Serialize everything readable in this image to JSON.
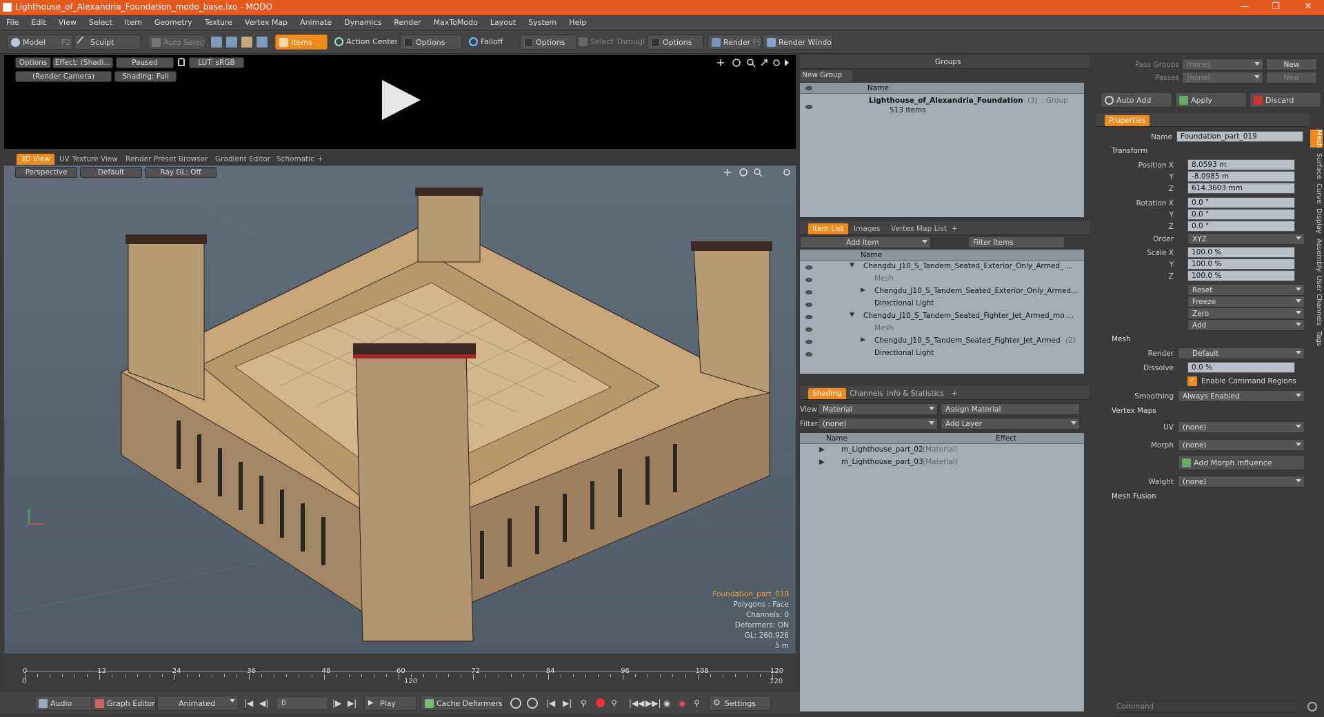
{
  "window": {
    "title": "Lighthouse_of_Alexandria_Foundation_modo_base.lxo - MODO",
    "minimize": "—",
    "maximize": "❐",
    "close": "✕"
  },
  "menu": [
    "File",
    "Edit",
    "View",
    "Select",
    "Item",
    "Geometry",
    "Texture",
    "Vertex Map",
    "Animate",
    "Dynamics",
    "Render",
    "MaxToModo",
    "Layout",
    "System",
    "Help"
  ],
  "toolbar": {
    "model": "Model",
    "model_key": "F2",
    "sculpt": "Sculpt",
    "auto_select": "Auto Select",
    "items": "Items",
    "action_center": "Action Center",
    "options1": "Options",
    "falloff": "Falloff",
    "options2": "Options",
    "select_through": "Select Through",
    "options3": "Options",
    "render": "Render",
    "render_key": "F9",
    "render_window": "Render Window"
  },
  "preview": {
    "options": "Options",
    "effect": "Effect: (Shadi...",
    "paused": "Paused",
    "lut": "LUT: sRGB",
    "camera": "(Render Camera)",
    "shading": "Shading: Full"
  },
  "viewport_tabs": [
    "3D View",
    "UV Texture View",
    "Render Preset Browser",
    "Gradient Editor",
    "Schematic",
    "+"
  ],
  "viewport": {
    "perspective": "Perspective",
    "default": "Default",
    "raygl": "Ray GL: Off",
    "info": {
      "name": "Foundation_part_019",
      "polygons": "Polygons : Face",
      "channels": "Channels: 0",
      "deformers": "Deformers: ON",
      "gl": "GL: 260,926",
      "scale": "5 m"
    }
  },
  "timeline": {
    "marks": [
      "0",
      "12",
      "24",
      "36",
      "48",
      "60",
      "72",
      "84",
      "96",
      "108",
      "120"
    ],
    "marks2": [
      "0",
      "120",
      "120"
    ],
    "audio": "Audio",
    "graph_editor": "Graph Editor",
    "animated": "Animated",
    "frame": "0",
    "play": "Play",
    "cache": "Cache Deformers",
    "settings": "Settings"
  },
  "groups": {
    "title": "Groups",
    "new_group": "New Group",
    "col_name": "Name",
    "item_name": "Lighthouse_of_Alexandria_Foundation",
    "item_count": "(3)",
    "item_type": ": Group",
    "item_sub": "513 Items"
  },
  "itemlist": {
    "tabs": [
      "Item List",
      "Images",
      "Vertex Map List",
      "+"
    ],
    "add_item": "Add Item",
    "filter": "Filter Items",
    "col_name": "Name",
    "rows": [
      {
        "text": "Chengdu_J10_S_Tandem_Seated_Exterior_Only_Armed_ ...",
        "indent": 0,
        "tri": "▼"
      },
      {
        "text": "Mesh",
        "indent": 1,
        "tri": "",
        "dim": true
      },
      {
        "text": "Chengdu_J10_S_Tandem_Seated_Exterior_Only_Armed...",
        "indent": 1,
        "tri": "▶"
      },
      {
        "text": "Directional Light",
        "indent": 1,
        "tri": ""
      },
      {
        "text": "Chengdu_J10_S_Tandem_Seated_Fighter_Jet_Armed_mo ...",
        "indent": 0,
        "tri": "▼"
      },
      {
        "text": "Mesh",
        "indent": 1,
        "tri": "",
        "dim": true
      },
      {
        "text": "Chengdu_J10_S_Tandem_Seated_Fighter_Jet_Armed",
        "indent": 1,
        "tri": "▶",
        "suffix": "(2)"
      },
      {
        "text": "Directional Light",
        "indent": 1,
        "tri": ""
      }
    ]
  },
  "shading": {
    "tabs": [
      "Shading",
      "Channels",
      "Info & Statistics",
      "+"
    ],
    "view_label": "View",
    "view_value": "Material",
    "assign": "Assign Material",
    "filter_label": "Filter",
    "filter_value": "(none)",
    "add_layer": "Add Layer",
    "col_name": "Name",
    "col_effect": "Effect",
    "rows": [
      {
        "name": "m_Lighthouse_part_02",
        "type": "(Material)"
      },
      {
        "name": "m_Lighthouse_part_03",
        "type": "(Material)"
      }
    ]
  },
  "pass": {
    "pass_groups": "Pass Groups",
    "passes": "Passes",
    "none": "(none)",
    "new": "New",
    "auto_add": "Auto Add",
    "apply": "Apply",
    "discard": "Discard"
  },
  "properties": {
    "tab": "Properties",
    "name_label": "Name",
    "name_value": "Foundation_part_019",
    "transform": "Transform",
    "position_label": "Position X",
    "pos": [
      "8.0593 m",
      "-8.0985 m",
      "614.3603 mm"
    ],
    "rotation_label": "Rotation X",
    "rot": [
      "0.0 °",
      "0.0 °",
      "0.0 °"
    ],
    "order_label": "Order",
    "order": "XYZ",
    "scale_label": "Scale X",
    "scale": [
      "100.0 %",
      "100.0 %",
      "100.0 %"
    ],
    "y": "Y",
    "z": "Z",
    "actions": [
      "Reset",
      "Freeze",
      "Zero",
      "Add"
    ],
    "mesh": "Mesh",
    "render_label": "Render",
    "render_value": "Default",
    "dissolve_label": "Dissolve",
    "dissolve_value": "0.0 %",
    "enable_cmd": "Enable Command Regions",
    "smoothing_label": "Smoothing",
    "smoothing_value": "Always Enabled",
    "vertex_maps": "Vertex Maps",
    "uv_label": "UV",
    "morph_label": "Morph",
    "weight_label": "Weight",
    "none": "(none)",
    "add_morph": "Add Morph Influence",
    "mesh_fusion": "Mesh Fusion",
    "vtabs": [
      "Mesh",
      "Surface",
      "Curve",
      "Display",
      "Assembly",
      "User Channels",
      "Tags"
    ]
  },
  "command": {
    "placeholder": "Command"
  }
}
